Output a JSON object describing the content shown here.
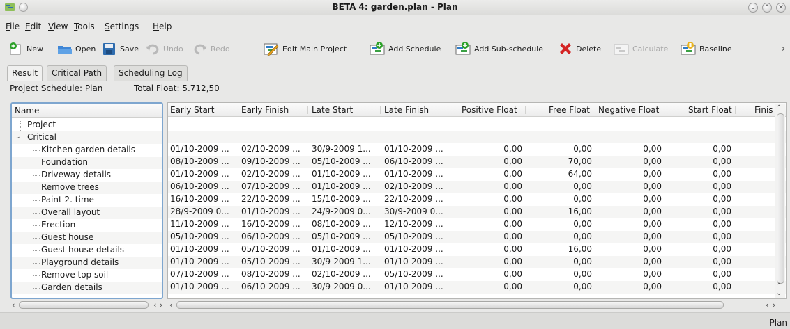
{
  "window": {
    "title": "BETA 4: garden.plan - Plan"
  },
  "menu": [
    {
      "label": "File",
      "u": "F"
    },
    {
      "label": "Edit",
      "u": "E"
    },
    {
      "label": "View",
      "u": "V"
    },
    {
      "label": "Tools",
      "u": "T"
    },
    {
      "label": "Settings",
      "u": "S"
    },
    {
      "label": "Help",
      "u": "H"
    }
  ],
  "toolbar": {
    "new": "New",
    "open": "Open",
    "save": "Save",
    "undo": "Undo",
    "redo": "Redo",
    "edit_main_project": "Edit Main Project",
    "add_schedule": "Add Schedule",
    "add_subschedule": "Add Sub-schedule",
    "delete": "Delete",
    "calculate": "Calculate",
    "baseline": "Baseline",
    "more": "›"
  },
  "tabs": [
    "Result",
    "Critical Path",
    "Scheduling Log"
  ],
  "summary": {
    "project_schedule": "Project Schedule:  Plan",
    "total_float": "Total Float: 5.712,50"
  },
  "tree_header": "Name",
  "columns": [
    "Early Start",
    "Early Finish",
    "Late Start",
    "Late Finish",
    "Positive Float",
    "Free Float",
    "Negative Float",
    "Start Float",
    "Finis"
  ],
  "tree": {
    "project": "Project",
    "critical": "Critical",
    "tasks": [
      "Kitchen garden details",
      "Foundation",
      "Driveway details",
      "Remove trees",
      "Paint 2. time",
      "Overall layout",
      "Erection",
      "Guest house",
      "Guest house details",
      "Playground details",
      "Remove top soil",
      "Garden details"
    ]
  },
  "rows": [
    {
      "es": "01/10-2009 ...",
      "ef": "02/10-2009 ...",
      "ls": "30/9-2009 1...",
      "lf": "01/10-2009 ...",
      "pf": "0,00",
      "ff": "0,00",
      "nf": "0,00",
      "sf": "0,00"
    },
    {
      "es": "08/10-2009 ...",
      "ef": "09/10-2009 ...",
      "ls": "05/10-2009 ...",
      "lf": "06/10-2009 ...",
      "pf": "0,00",
      "ff": "70,00",
      "nf": "0,00",
      "sf": "0,00"
    },
    {
      "es": "01/10-2009 ...",
      "ef": "02/10-2009 ...",
      "ls": "01/10-2009 ...",
      "lf": "01/10-2009 ...",
      "pf": "0,00",
      "ff": "64,00",
      "nf": "0,00",
      "sf": "0,00"
    },
    {
      "es": "06/10-2009 ...",
      "ef": "07/10-2009 ...",
      "ls": "01/10-2009 ...",
      "lf": "02/10-2009 ...",
      "pf": "0,00",
      "ff": "0,00",
      "nf": "0,00",
      "sf": "0,00"
    },
    {
      "es": "16/10-2009 ...",
      "ef": "22/10-2009 ...",
      "ls": "15/10-2009 ...",
      "lf": "22/10-2009 ...",
      "pf": "0,00",
      "ff": "0,00",
      "nf": "0,00",
      "sf": "0,00"
    },
    {
      "es": "28/9-2009 0...",
      "ef": "01/10-2009 ...",
      "ls": "24/9-2009 0...",
      "lf": "30/9-2009 0...",
      "pf": "0,00",
      "ff": "16,00",
      "nf": "0,00",
      "sf": "0,00"
    },
    {
      "es": "11/10-2009 ...",
      "ef": "16/10-2009 ...",
      "ls": "08/10-2009 ...",
      "lf": "12/10-2009 ...",
      "pf": "0,00",
      "ff": "0,00",
      "nf": "0,00",
      "sf": "0,00"
    },
    {
      "es": "05/10-2009 ...",
      "ef": "06/10-2009 ...",
      "ls": "05/10-2009 ...",
      "lf": "05/10-2009 ...",
      "pf": "0,00",
      "ff": "0,00",
      "nf": "0,00",
      "sf": "0,00"
    },
    {
      "es": "01/10-2009 ...",
      "ef": "05/10-2009 ...",
      "ls": "01/10-2009 ...",
      "lf": "01/10-2009 ...",
      "pf": "0,00",
      "ff": "16,00",
      "nf": "0,00",
      "sf": "0,00"
    },
    {
      "es": "01/10-2009 ...",
      "ef": "05/10-2009 ...",
      "ls": "30/9-2009 1...",
      "lf": "01/10-2009 ...",
      "pf": "0,00",
      "ff": "0,00",
      "nf": "0,00",
      "sf": "0,00"
    },
    {
      "es": "07/10-2009 ...",
      "ef": "08/10-2009 ...",
      "ls": "02/10-2009 ...",
      "lf": "05/10-2009 ...",
      "pf": "0,00",
      "ff": "0,00",
      "nf": "0,00",
      "sf": "0,00"
    },
    {
      "es": "01/10-2009 ...",
      "ef": "06/10-2009 ...",
      "ls": "30/9-2009 0...",
      "lf": "01/10-2009 ...",
      "pf": "0,00",
      "ff": "0,00",
      "nf": "0,00",
      "sf": "0,00"
    }
  ],
  "status": {
    "right": "Plan"
  }
}
